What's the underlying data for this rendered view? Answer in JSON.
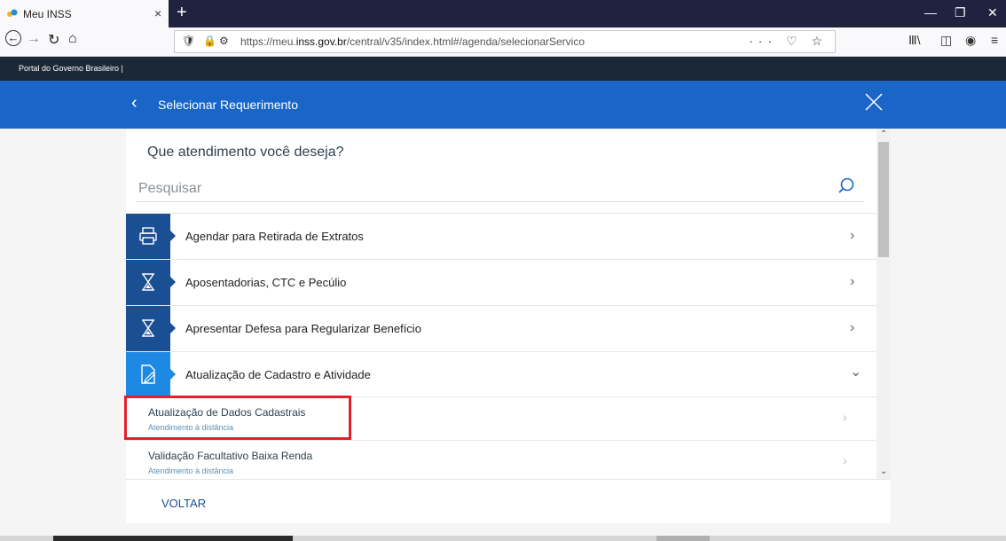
{
  "browser": {
    "tab_title": "Meu INSS",
    "tab_close": "×",
    "new_tab": "+",
    "url_prefix": "https://meu.",
    "url_host": "inss.gov.br",
    "url_path": "/central/v35/index.html#/agenda/selecionarServico",
    "url_actions": "··· ♡ ☆",
    "back": "←",
    "forward": "→",
    "reload": "↻",
    "home": "⌂",
    "library": "Ⅲ\\",
    "sidebar": "◫",
    "account": "◉",
    "menu": "≡",
    "minimize": "—",
    "restore": "❐",
    "close": "✕"
  },
  "govbar": {
    "text": "Portal do Governo Brasileiro  |"
  },
  "header": {
    "back": "‹",
    "title": "Selecionar Requerimento"
  },
  "main": {
    "question": "Que atendimento você deseja?",
    "search_placeholder": "Pesquisar",
    "rows": [
      {
        "label": "Agendar para Retirada de Extratos",
        "icon": "printer-icon",
        "chevron": "›"
      },
      {
        "label": "Aposentadorias, CTC e Pecúlio",
        "icon": "hourglass-icon",
        "chevron": "›"
      },
      {
        "label": "Apresentar Defesa para Regularizar Benefício",
        "icon": "hourglass-icon",
        "chevron": "›"
      },
      {
        "label": "Atualização de Cadastro e Atividade",
        "icon": "edit-document-icon",
        "chevron": "⌄"
      }
    ],
    "subitems": [
      {
        "title": "Atualização de Dados Cadastrais",
        "caption": "Atendimento à distância",
        "chevron": "›"
      },
      {
        "title": "Validação Facultativo Baixa Renda",
        "caption": "Atendimento à distância",
        "chevron": "›"
      }
    ],
    "voltar": "VOLTAR"
  },
  "scrollbar": {
    "up": "⌃",
    "down": "⌄"
  },
  "colors": {
    "header_blue": "#1966c8",
    "icon_navy": "#1a4f93",
    "icon_active": "#1e88e5",
    "highlight_red": "#e0202a"
  }
}
